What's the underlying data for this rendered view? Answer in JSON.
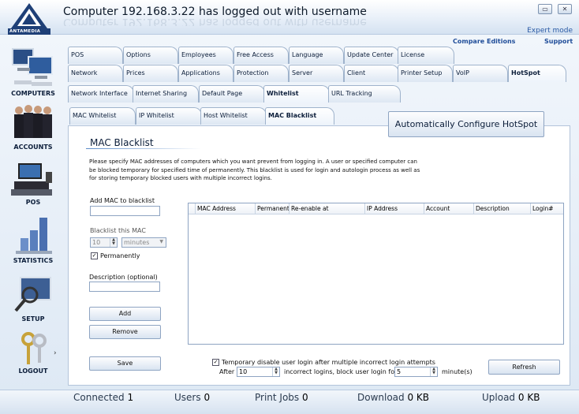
{
  "window": {
    "title": "Computer 192.168.3.22 has logged out with username",
    "expert_mode": "Expert mode",
    "compare_editions": "Compare Editions",
    "support": "Support",
    "logo_text": "ANTAMEDIA",
    "minimize_glyph": "▭",
    "close_glyph": "✕"
  },
  "sidebar": {
    "items": [
      {
        "label": "COMPUTERS"
      },
      {
        "label": "ACCOUNTS"
      },
      {
        "label": "POS"
      },
      {
        "label": "STATISTICS"
      },
      {
        "label": "SETUP"
      },
      {
        "label": "LOGOUT"
      }
    ],
    "arrow": "›"
  },
  "tabs_row1": [
    "POS",
    "Options",
    "Employees",
    "Free Access",
    "Language",
    "Update Center",
    "License"
  ],
  "tabs_row2": [
    "Network",
    "Prices",
    "Applications",
    "Protection",
    "Server",
    "Client",
    "Printer Setup",
    "VoIP",
    "HotSpot"
  ],
  "tabs_row3": [
    "Network Interface",
    "Internet Sharing",
    "Default Page",
    "Whitelist",
    "URL Tracking"
  ],
  "tabs_row4": [
    "MAC Whitelist",
    "IP Whitelist",
    "Host Whitelist",
    "MAC Blacklist"
  ],
  "auto_configure_button": "Automatically Configure HotSpot",
  "panel": {
    "title": "MAC Blacklist",
    "description": "Please specify MAC addresses of computers which you want prevent from logging in. A user or specified computer can be blocked temporary for specified time of permanently. This blacklist is used for login and autologin process as well as for storing temporary blocked users with multiple incorrect logins.",
    "add_mac_label": "Add MAC to blacklist",
    "add_mac_value": "",
    "blacklist_label": "Blacklist this MAC",
    "blacklist_amount": "10",
    "blacklist_unit": "minutes",
    "permanently_label": "Permanently",
    "permanently_checked": true,
    "desc_label": "Description (optional)",
    "desc_value": "",
    "add_button": "Add",
    "remove_button": "Remove",
    "save_button": "Save",
    "refresh_button": "Refresh",
    "columns": [
      "MAC Address",
      "Permanent",
      "Re-enable at",
      "IP Address",
      "Account",
      "Description",
      "Login#"
    ],
    "rows": [],
    "temp_disable_label": "Temporary disable user login after multiple incorrect login attempts",
    "temp_disable_checked": true,
    "after_label": "After",
    "after_value": "10",
    "incorrect_label": "incorrect logins, block user login for",
    "block_minutes": "5",
    "minutes_label": "minute(s)"
  },
  "statusbar": {
    "connected_label": "Connected",
    "connected_value": "1",
    "users_label": "Users",
    "users_value": "0",
    "printjobs_label": "Print Jobs",
    "printjobs_value": "0",
    "download_label": "Download",
    "download_value": "0 KB",
    "upload_label": "Upload",
    "upload_value": "0 KB"
  }
}
